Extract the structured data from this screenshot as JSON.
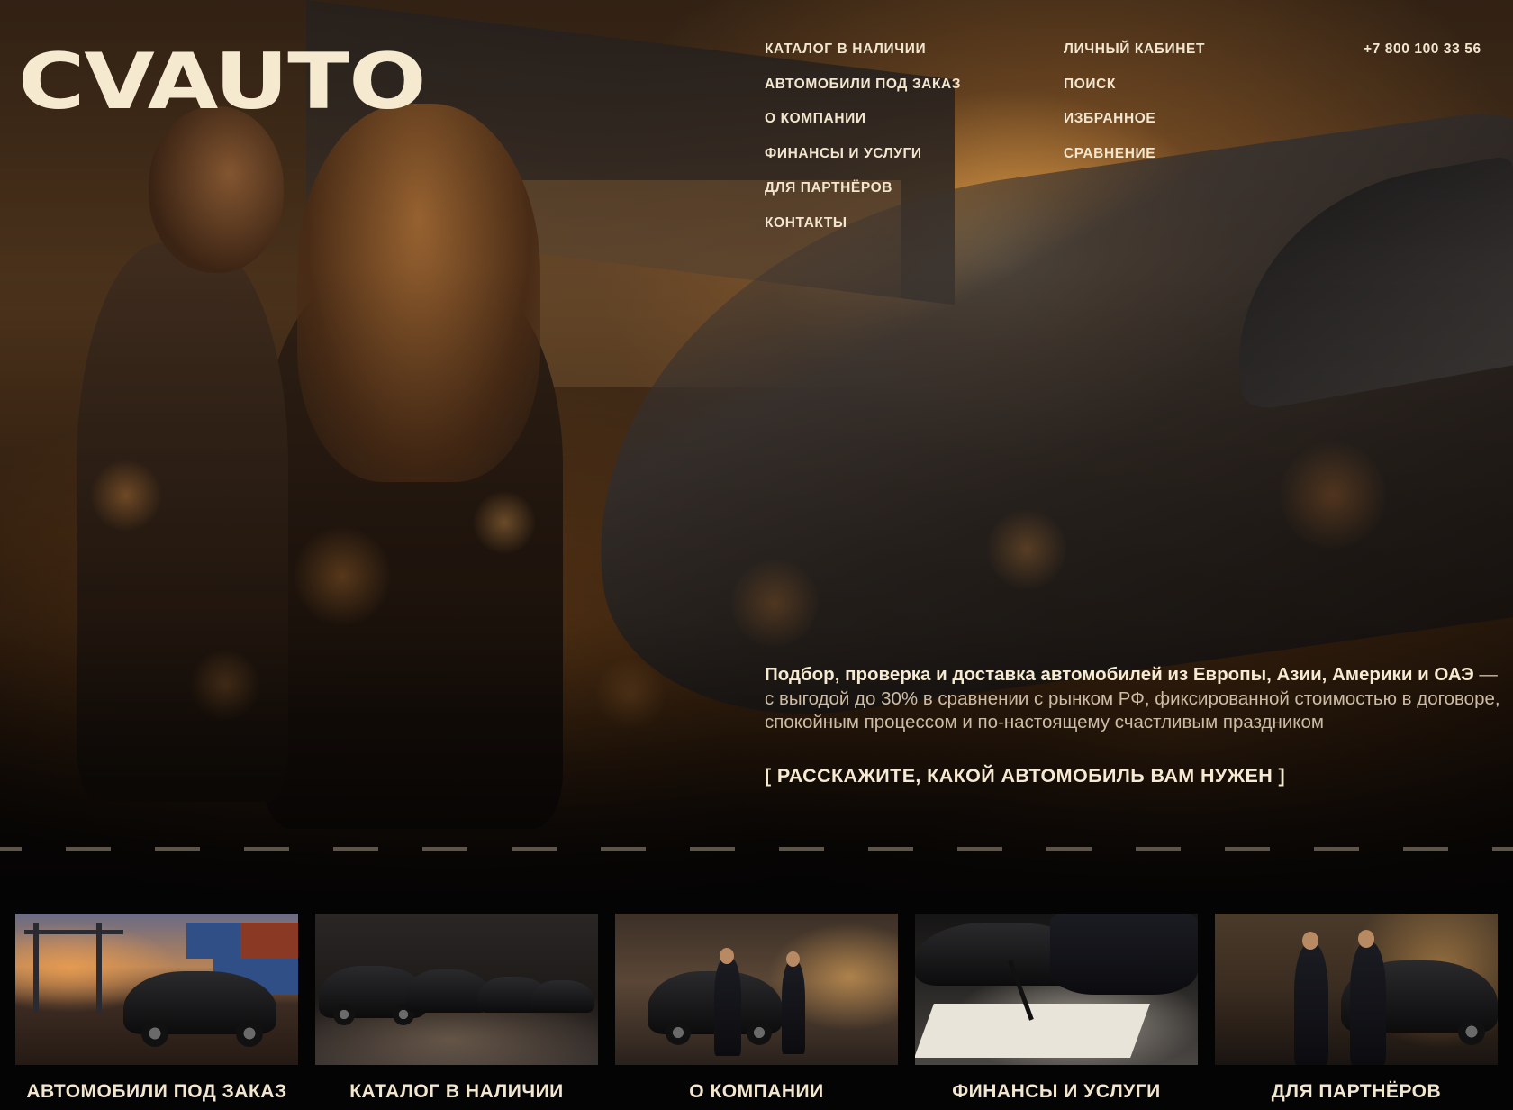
{
  "brand": {
    "logo": "CVAUTO"
  },
  "nav": {
    "col1": [
      "КАТАЛОГ В НАЛИЧИИ",
      "АВТОМОБИЛИ ПОД ЗАКАЗ",
      "О КОМПАНИИ",
      "ФИНАНСЫ И УСЛУГИ",
      "ДЛЯ ПАРТНЁРОВ",
      "КОНТАКТЫ"
    ],
    "col2": [
      "ЛИЧНЫЙ КАБИНЕТ",
      "ПОИСК",
      "ИЗБРАННОЕ",
      "СРАВНЕНИЕ"
    ]
  },
  "phone": "+7 800 100 33 56",
  "intro": {
    "headline": "Подбор, проверка и доставка автомобилей из Европы, Азии, Америки и ОАЭ",
    "body": " — с выгодой до 30% в сравнении с рынком РФ, фиксированной стоимостью в договоре, спокойным процессом и по-настоящему счастливым праздником"
  },
  "cta": "[ РАССКАЖИТЕ, КАКОЙ АВТОМОБИЛЬ ВАМ НУЖЕН ]",
  "cards": [
    {
      "label": "АВТОМОБИЛИ ПОД ЗАКАЗ",
      "image": "cargo-port-suv"
    },
    {
      "label": "КАТАЛОГ В НАЛИЧИИ",
      "image": "garage-cars"
    },
    {
      "label": "О КОМПАНИИ",
      "image": "showroom-meeting"
    },
    {
      "label": "ФИНАНСЫ И УСЛУГИ",
      "image": "signing-contract"
    },
    {
      "label": "ДЛЯ ПАРТНЁРОВ",
      "image": "partners-handshake"
    }
  ],
  "colors": {
    "text": "#f3e6cf",
    "background": "#050404",
    "accent": "#e8a85a"
  }
}
